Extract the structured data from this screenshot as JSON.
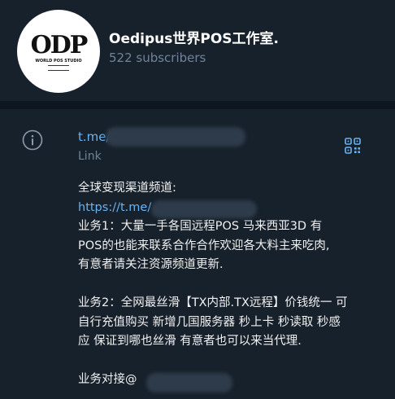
{
  "channel": {
    "avatar_text": "ODP",
    "avatar_subtext": "WORLD POS STUDIO",
    "title": "Oedipus世界POS工作室.",
    "subscribers": "522 subscribers"
  },
  "info": {
    "link_url": "t.me/",
    "link_caption": "Link",
    "description": {
      "line1": "全球变现渠道频道:",
      "line2_link": "https://t.me/",
      "line3": "业务1：大量一手各国远程POS 马来西亚3D 有",
      "line4": "POS的也能来联系合作合作欢迎各大料主来吃肉,",
      "line5": "有意者请关注资源频道更新.",
      "line6": "业务2：全网最丝滑【TX内部.TX远程】价钱统一 可",
      "line7": "自行充值购买 新增几国服务器 秒上卡 秒读取 秒感",
      "line8": "应 保证到哪也丝滑 有意者也可以来当代理.",
      "line9": "业务对接@"
    }
  },
  "colors": {
    "background": "#17212b",
    "divider": "#0e1621",
    "link": "#6ab3f3",
    "muted": "#708499",
    "text": "#f0f0f0"
  },
  "icons": {
    "info": "info-circle-icon",
    "qr": "qr-code-icon"
  }
}
